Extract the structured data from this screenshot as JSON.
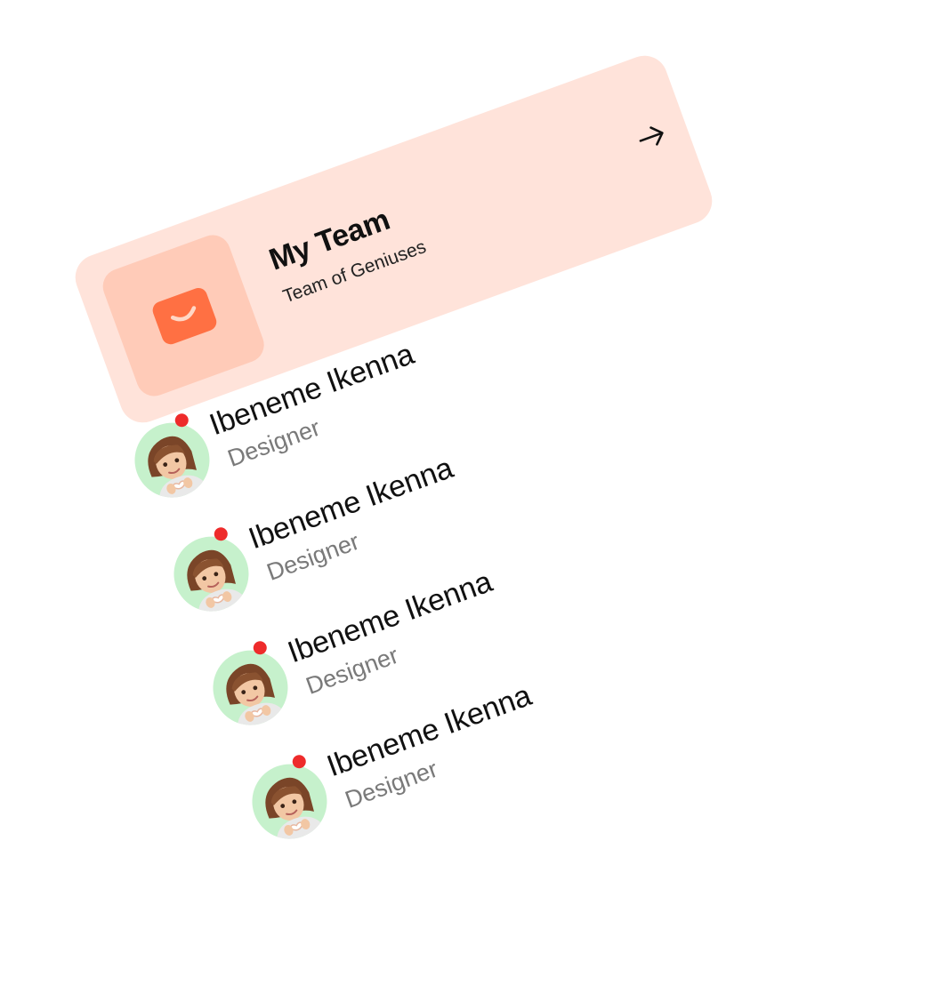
{
  "team_card": {
    "title": "My Team",
    "subtitle": "Team of Geniuses",
    "icon": "wallet-icon",
    "arrow_icon": "arrow-up-right-icon",
    "card_color": "#ffe3da",
    "icon_box_color": "#ffcbb8",
    "icon_color": "#ff7043"
  },
  "members": [
    {
      "name": "Ibeneme Ikenna",
      "role": "Designer",
      "online": true
    },
    {
      "name": "Ibeneme Ikenna",
      "role": "Designer",
      "online": true
    },
    {
      "name": "Ibeneme Ikenna",
      "role": "Designer",
      "online": true
    },
    {
      "name": "Ibeneme Ikenna",
      "role": "Designer",
      "online": true
    }
  ],
  "colors": {
    "avatar_bg": "#c6f1cc",
    "status_dot": "#ee2b2b",
    "role_text": "#7a7a7a"
  }
}
